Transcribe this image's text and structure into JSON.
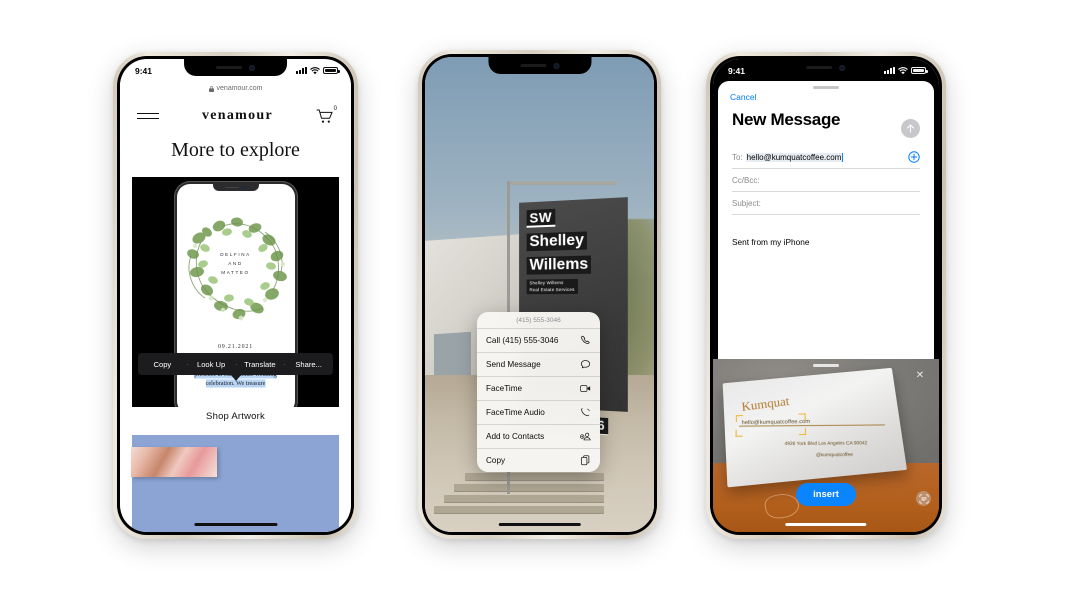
{
  "scene": {
    "background": "#ffffff",
    "device_count": 3
  },
  "phone1": {
    "name": "safari-venamour",
    "status": {
      "time": "9:41"
    },
    "browser": {
      "url": "venamour.com",
      "lock_icon": "lock-icon"
    },
    "nav": {
      "menu_icon": "hamburger-menu-icon",
      "brand": "venamour",
      "cart_icon": "cart-icon",
      "cart_count": "0"
    },
    "hero_heading": "More to explore",
    "invitation": {
      "name_line_1": "DELFINA",
      "name_line_2": "AND",
      "name_line_3": "MATTEO",
      "date": "09.21.2021",
      "selected_text": "We would be delighted by your presence at our intimate wedding celebration. We treasure"
    },
    "edit_menu": {
      "items": [
        "Copy",
        "Look Up",
        "Translate",
        "Share..."
      ]
    },
    "shop_link": "Shop Artwork"
  },
  "phone2": {
    "name": "camera-live-text",
    "sign": {
      "monogram": "SW",
      "name_line_1": "Shelley",
      "name_line_2": "Willems",
      "sub_line_1": "Shelley Willems",
      "sub_line_2": "Real Estate Services",
      "phone": "(415) 555-3046"
    },
    "context_menu": {
      "title": "(415) 555-3046",
      "items": [
        {
          "label": "Call (415) 555-3046",
          "icon": "phone-icon"
        },
        {
          "label": "Send Message",
          "icon": "message-bubble-icon"
        },
        {
          "label": "FaceTime",
          "icon": "video-camera-icon"
        },
        {
          "label": "FaceTime Audio",
          "icon": "phone-wave-icon"
        },
        {
          "label": "Add to Contacts",
          "icon": "person-add-icon"
        },
        {
          "label": "Copy",
          "icon": "copy-icon"
        }
      ]
    }
  },
  "phone3": {
    "name": "mail-compose-live-text",
    "status": {
      "time": "9:41",
      "camera_indicator": "green-dot-icon"
    },
    "compose": {
      "cancel_label": "Cancel",
      "title": "New Message",
      "send_icon": "send-arrow-up-icon",
      "to_label": "To:",
      "to_value": "hello@kumquatcoffee.com",
      "add_contact_icon": "plus-circle-icon",
      "cc_placeholder": "Cc/Bcc:",
      "subject_placeholder": "Subject:",
      "signature": "Sent from my iPhone"
    },
    "camera_card": {
      "brand": "Kumquat",
      "email": "hello@kumquatcoffee.com",
      "address": "4936 York Blvd Los Angeles CA 90042",
      "handle": "@kumquatcoffee",
      "close_icon": "close-x-icon",
      "insert_label": "insert",
      "scan_icon": "live-text-scan-icon"
    }
  },
  "colors": {
    "ios_blue": "#007aff",
    "insert_blue": "#0a84ff",
    "selection_blue": "#b7d4f5",
    "scan_yellow": "#f0b429",
    "green_dot": "#30d158"
  }
}
